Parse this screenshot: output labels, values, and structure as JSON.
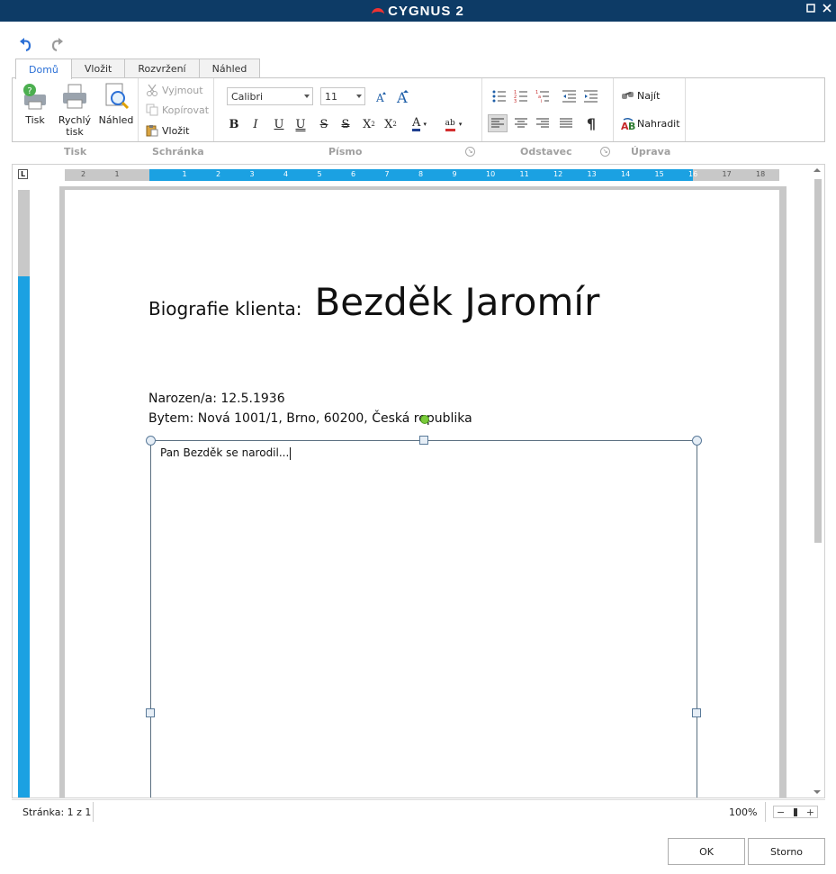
{
  "window": {
    "app_name": "CYGNUS 2"
  },
  "quick_access": {
    "undo": "undo-icon",
    "redo": "redo-icon"
  },
  "tabs": [
    {
      "label": "Domů",
      "active": true
    },
    {
      "label": "Vložit",
      "active": false
    },
    {
      "label": "Rozvržení",
      "active": false
    },
    {
      "label": "Náhled",
      "active": false
    }
  ],
  "ribbon": {
    "tisk": {
      "group_label": "Tisk",
      "print": "Tisk",
      "quick_print_line1": "Rychlý",
      "quick_print_line2": "tisk",
      "preview": "Náhled"
    },
    "schranka": {
      "group_label": "Schránka",
      "cut": "Vyjmout",
      "copy": "Kopírovat",
      "paste": "Vložit"
    },
    "pismo": {
      "group_label": "Písmo",
      "font_family": "Calibri",
      "font_size": "11",
      "bold": "B",
      "italic": "I",
      "underline": "U",
      "double_underline": "U",
      "strike": "S",
      "double_strike": "S",
      "subscript": "X",
      "superscript": "X",
      "font_color": "A",
      "highlight": "ab"
    },
    "odstavec": {
      "group_label": "Odstavec",
      "pilcrow": "¶"
    },
    "uprava": {
      "group_label": "Úprava",
      "find": "Najít",
      "replace": "Nahradit"
    }
  },
  "ruler": {
    "corner": "L",
    "numbers": [
      "2",
      "1",
      "",
      "1",
      "2",
      "3",
      "4",
      "5",
      "6",
      "7",
      "8",
      "9",
      "10",
      "11",
      "12",
      "13",
      "14",
      "15",
      "16",
      "17",
      "18"
    ]
  },
  "document": {
    "label": "Biografie klienta:",
    "name": "Bezděk Jaromír",
    "born": "Narozen/a: 12.5.1936",
    "address": "Bytem: Nová 1001/1, Brno, 60200, Česká republika",
    "textbox_content": "Pan Bezděk se narodil..."
  },
  "status": {
    "page": "Stránka: 1 z 1",
    "zoom": "100%",
    "zoom_minus": "−",
    "zoom_plus": "+"
  },
  "buttons": {
    "ok": "OK",
    "cancel": "Storno"
  },
  "colors": {
    "titlebar": "#0d3b66",
    "ruler_active": "#1ba1e2",
    "tab_active_text": "#2a6fd6"
  }
}
